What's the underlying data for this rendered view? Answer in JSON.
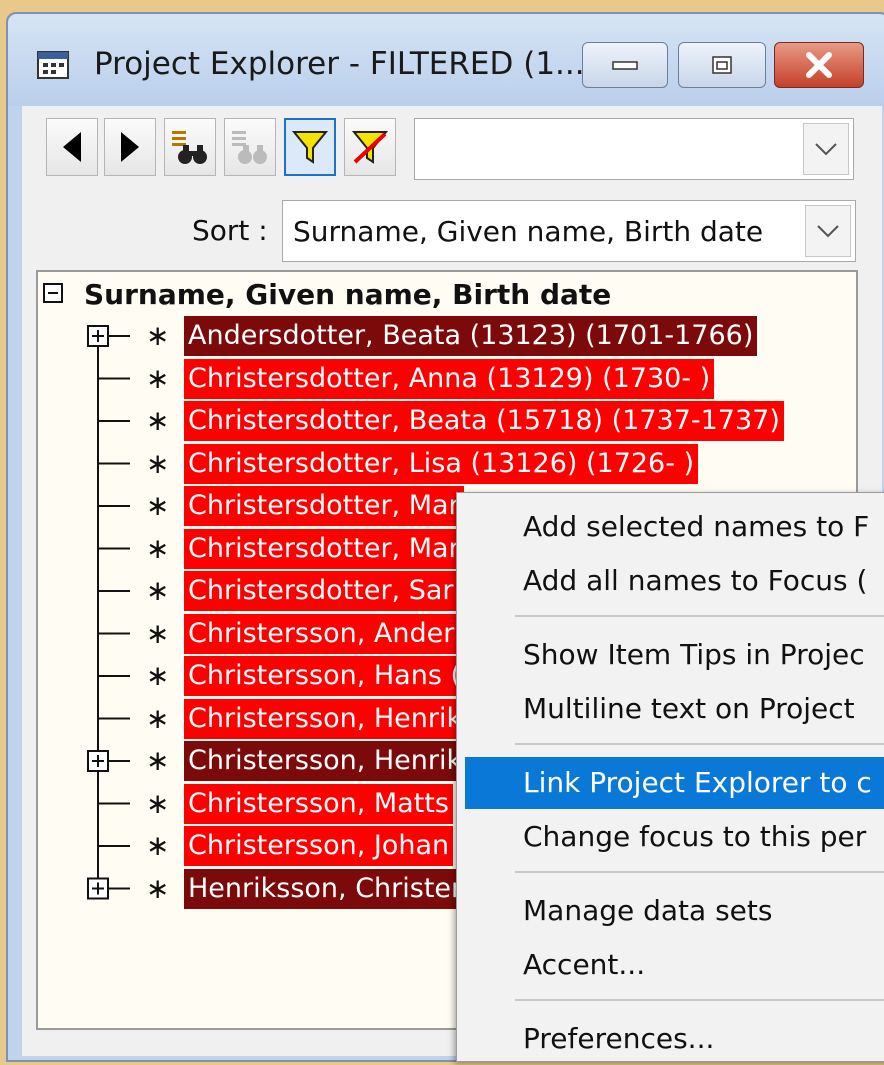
{
  "window": {
    "title": "Project Explorer - FILTERED (1..."
  },
  "icons": {
    "app": "calendar-app-icon",
    "back": "arrow-left-icon",
    "forward": "arrow-right-icon",
    "find": "binoculars-icon",
    "find_disabled": "binoculars-disabled-icon",
    "filter": "funnel-icon",
    "clear_filter": "funnel-clear-icon",
    "dropdown": "chevron-down-icon"
  },
  "filter_combo": {
    "value": ""
  },
  "sort": {
    "label": "Sort :",
    "value": "Surname, Given name, Birth date"
  },
  "tree": {
    "root_label": "Surname, Given name, Birth date",
    "items": [
      {
        "label": "Andersdotter, Beata (13123) (1701-1766)",
        "style": "dark",
        "expandable": true
      },
      {
        "label": "Christersdotter, Anna (13129) (1730-   )",
        "style": "bright",
        "expandable": false
      },
      {
        "label": "Christersdotter, Beata (15718) (1737-1737)",
        "style": "bright",
        "expandable": false
      },
      {
        "label": "Christersdotter, Lisa (13126) (1726-   )",
        "style": "bright",
        "expandable": false
      },
      {
        "label": "Christersdotter, Mar",
        "style": "bright",
        "expandable": false
      },
      {
        "label": "Christersdotter, Mar",
        "style": "bright",
        "expandable": false
      },
      {
        "label": "Christersdotter, Sar",
        "style": "bright",
        "expandable": false
      },
      {
        "label": "Christersson, Ander",
        "style": "bright",
        "expandable": false
      },
      {
        "label": "Christersson, Hans (",
        "style": "bright",
        "expandable": false
      },
      {
        "label": "Christersson, Henrik",
        "style": "bright",
        "expandable": false
      },
      {
        "label": "Christersson, Henrik",
        "style": "dark",
        "expandable": true
      },
      {
        "label": "Christersson, Matts",
        "style": "bright",
        "expandable": false
      },
      {
        "label": "Christersson, Johan",
        "style": "bright",
        "expandable": false
      },
      {
        "label": "Henriksson, Christer",
        "style": "dark",
        "expandable": true
      }
    ]
  },
  "colors": {
    "selected_bright": "#ff0000",
    "selected_dark": "#7d0a0a",
    "menu_highlight": "#0a78d7",
    "tree_background": "#fffdf3"
  },
  "context_menu": {
    "items": [
      {
        "label": "Add selected names to F",
        "highlighted": false
      },
      {
        "label": "Add all names to Focus (",
        "highlighted": false
      },
      {
        "label": "Show Item Tips in Projec",
        "highlighted": false
      },
      {
        "label": "Multiline text on Project",
        "highlighted": false
      },
      {
        "label": "Link Project Explorer to c",
        "highlighted": true
      },
      {
        "label": "Change focus to this per",
        "highlighted": false
      },
      {
        "label": "Manage data sets",
        "highlighted": false
      },
      {
        "label": "Accent...",
        "highlighted": false
      },
      {
        "label": "Preferences...",
        "highlighted": false
      }
    ]
  }
}
